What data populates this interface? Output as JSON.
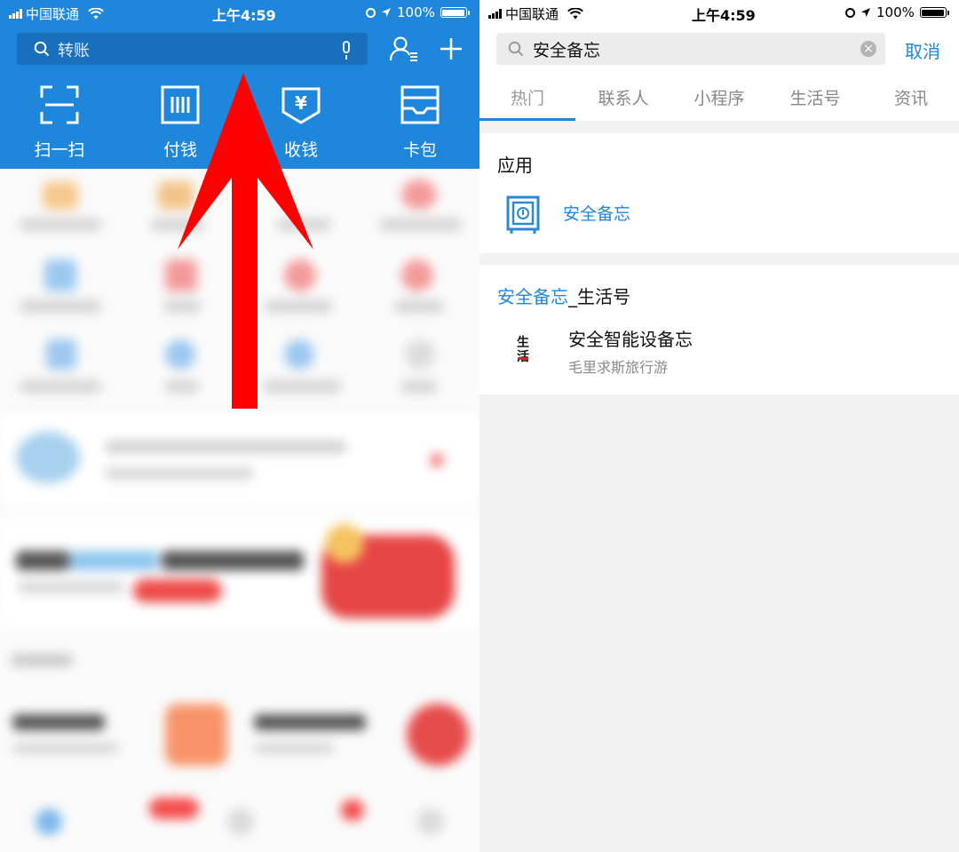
{
  "left": {
    "status": {
      "carrier": "中国联通",
      "time": "上午4:59",
      "battery": "100%"
    },
    "search": {
      "placeholder": "转账"
    },
    "tools": [
      {
        "label": "扫一扫",
        "icon": "scan-icon"
      },
      {
        "label": "付钱",
        "icon": "pay-icon"
      },
      {
        "label": "收钱",
        "icon": "receive-money-icon"
      },
      {
        "label": "卡包",
        "icon": "card-wallet-icon"
      }
    ],
    "arrow_color": "#ff0000",
    "theme_color": "#1e86db"
  },
  "right": {
    "status": {
      "carrier": "中国联通",
      "time": "上午4:59",
      "battery": "100%"
    },
    "search": {
      "value": "安全备忘"
    },
    "cancel": "取消",
    "tabs": [
      "热门",
      "联系人",
      "小程序",
      "生活号",
      "资讯"
    ],
    "app_section": {
      "title": "应用",
      "item": "安全备忘"
    },
    "life_section": {
      "title_highlight": "安全备忘",
      "title_rest": "_生活号",
      "item_name": "安全智能设备忘",
      "item_sub": "毛里求斯旅行游",
      "logo_text": "生活"
    },
    "accent_color": "#1e86db"
  }
}
